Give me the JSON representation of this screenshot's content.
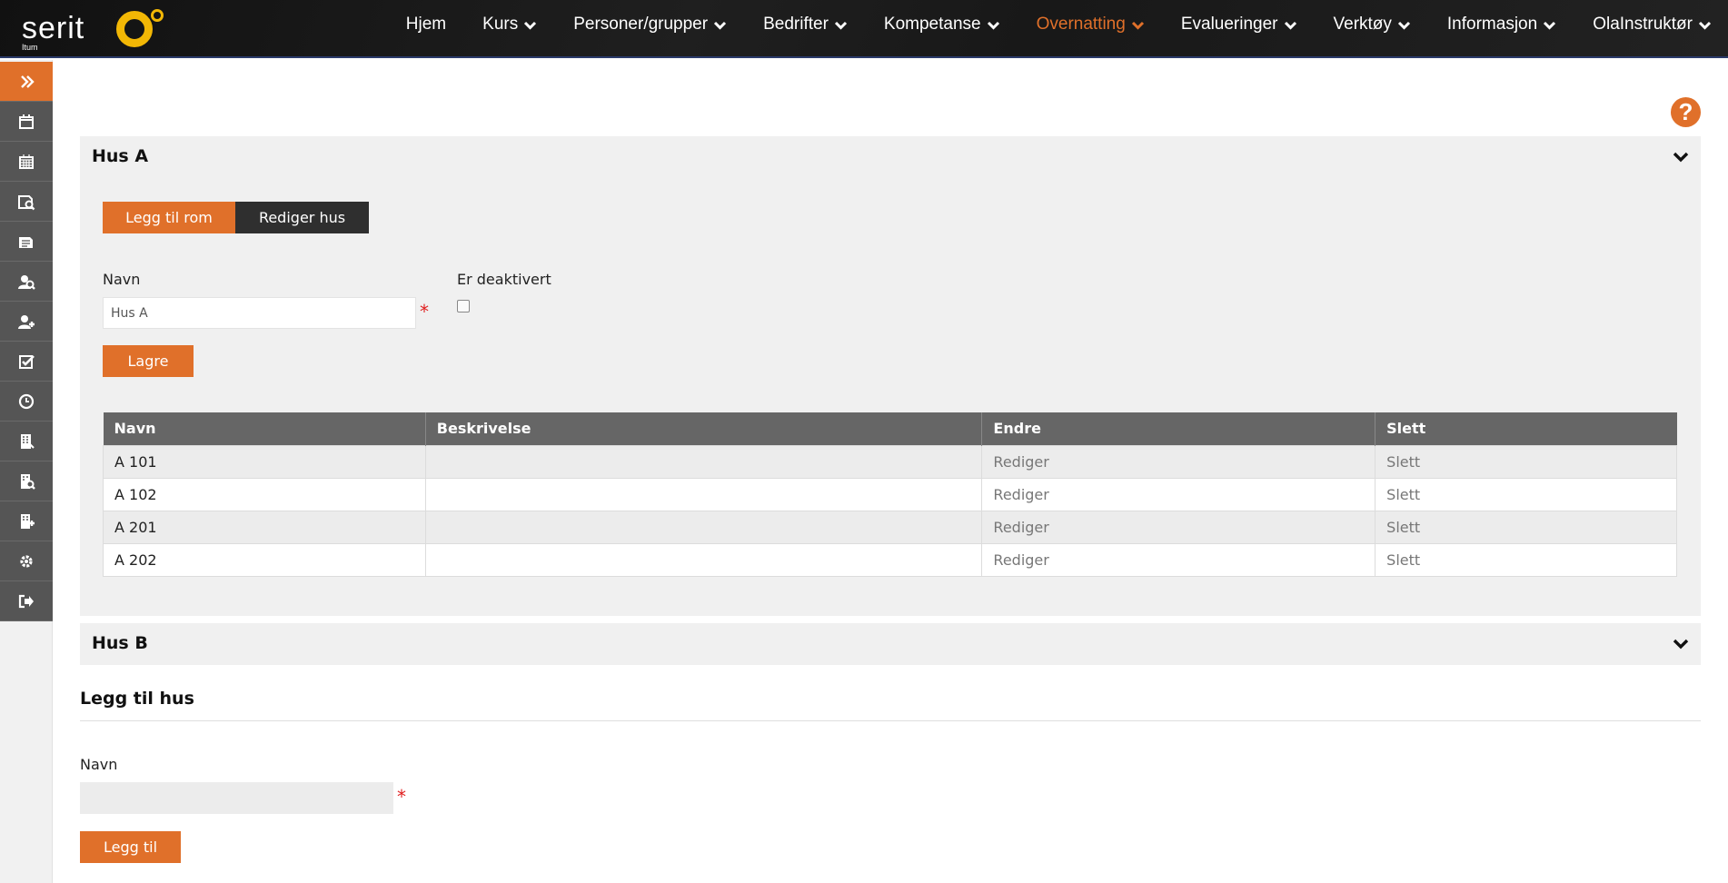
{
  "logo": {
    "word": "serit",
    "sub": "Itum"
  },
  "colors": {
    "accent": "#e0702a",
    "dark_button": "#2f2f2f",
    "header_bg": "#151515",
    "table_header": "#666666",
    "required": "#e02020"
  },
  "nav": [
    {
      "label": "Hjem",
      "dropdown": false,
      "active": false
    },
    {
      "label": "Kurs",
      "dropdown": true,
      "active": false
    },
    {
      "label": "Personer/grupper",
      "dropdown": true,
      "active": false
    },
    {
      "label": "Bedrifter",
      "dropdown": true,
      "active": false
    },
    {
      "label": "Kompetanse",
      "dropdown": true,
      "active": false
    },
    {
      "label": "Overnatting",
      "dropdown": true,
      "active": true
    },
    {
      "label": "Evalueringer",
      "dropdown": true,
      "active": false
    },
    {
      "label": "Verktøy",
      "dropdown": true,
      "active": false
    },
    {
      "label": "Informasjon",
      "dropdown": true,
      "active": false
    },
    {
      "label": "OlaInstruktør",
      "dropdown": true,
      "active": false
    }
  ],
  "sidebar": {
    "items": [
      {
        "icon": "double-chevron-right-icon",
        "name": "sidebar-toggle"
      },
      {
        "icon": "calendar-icon",
        "name": "sidebar-item-calendar"
      },
      {
        "icon": "calendar-grid-icon",
        "name": "sidebar-item-schedule"
      },
      {
        "icon": "course-search-icon",
        "name": "sidebar-item-course-search"
      },
      {
        "icon": "course-edit-icon",
        "name": "sidebar-item-course-edit"
      },
      {
        "icon": "person-search-icon",
        "name": "sidebar-item-person-search"
      },
      {
        "icon": "person-add-icon",
        "name": "sidebar-item-person-add"
      },
      {
        "icon": "checkbox-icon",
        "name": "sidebar-item-tasks"
      },
      {
        "icon": "clock-icon",
        "name": "sidebar-item-history"
      },
      {
        "icon": "building-icon",
        "name": "sidebar-item-company"
      },
      {
        "icon": "building-search-icon",
        "name": "sidebar-item-company-search"
      },
      {
        "icon": "building-edit-icon",
        "name": "sidebar-item-company-edit"
      },
      {
        "icon": "gear-icon",
        "name": "sidebar-item-settings"
      },
      {
        "icon": "sign-out-icon",
        "name": "sidebar-item-logout"
      }
    ]
  },
  "help": {
    "label": "?"
  },
  "house_a": {
    "title": "Hus A",
    "add_room_label": "Legg til rom",
    "edit_house_label": "Rediger hus",
    "name_label": "Navn",
    "name_value": "Hus A",
    "required_mark": "*",
    "deactivated_label": "Er deaktivert",
    "save_label": "Lagre",
    "table": {
      "headers": [
        "Navn",
        "Beskrivelse",
        "Endre",
        "Slett"
      ],
      "rows": [
        {
          "name": "A 101",
          "description": "",
          "edit": "Rediger",
          "delete": "Slett"
        },
        {
          "name": "A 102",
          "description": "",
          "edit": "Rediger",
          "delete": "Slett"
        },
        {
          "name": "A 201",
          "description": "",
          "edit": "Rediger",
          "delete": "Slett"
        },
        {
          "name": "A 202",
          "description": "",
          "edit": "Rediger",
          "delete": "Slett"
        }
      ]
    }
  },
  "house_b": {
    "title": "Hus B"
  },
  "add_house": {
    "title": "Legg til hus",
    "name_label": "Navn",
    "name_value": "",
    "required_mark": "*",
    "submit_label": "Legg til"
  }
}
